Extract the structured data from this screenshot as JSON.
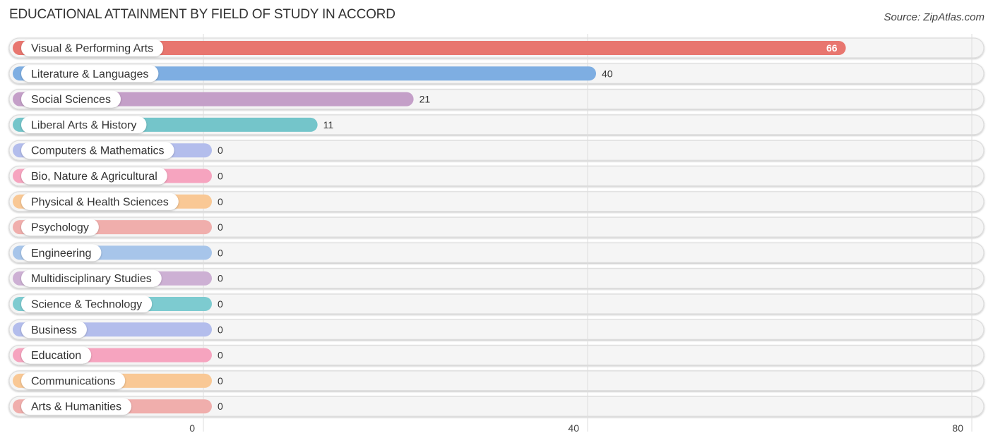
{
  "chart_data": {
    "type": "bar",
    "orientation": "horizontal",
    "title": "EDUCATIONAL ATTAINMENT BY FIELD OF STUDY IN ACCORD",
    "source": "Source: ZipAtlas.com",
    "xlim": [
      0,
      80
    ],
    "xticks": [
      "0",
      "40",
      "80"
    ],
    "grid": true,
    "categories": [
      "Visual & Performing Arts",
      "Literature & Languages",
      "Social Sciences",
      "Liberal Arts & History",
      "Computers & Mathematics",
      "Bio, Nature & Agricultural",
      "Physical & Health Sciences",
      "Psychology",
      "Engineering",
      "Multidisciplinary Studies",
      "Science & Technology",
      "Business",
      "Education",
      "Communications",
      "Arts & Humanities"
    ],
    "values": [
      66,
      40,
      21,
      11,
      0,
      0,
      0,
      0,
      0,
      0,
      0,
      0,
      0,
      0,
      0
    ],
    "colors": [
      "#e8766f",
      "#7eaee2",
      "#c49fc8",
      "#74c5ca",
      "#b3bdec",
      "#f6a4bf",
      "#f9c895",
      "#f0aeac",
      "#a7c5ea",
      "#cdb0d4",
      "#7dcbd0",
      "#b3bdec",
      "#f6a4bf",
      "#f9c895",
      "#f0aeac"
    ]
  }
}
